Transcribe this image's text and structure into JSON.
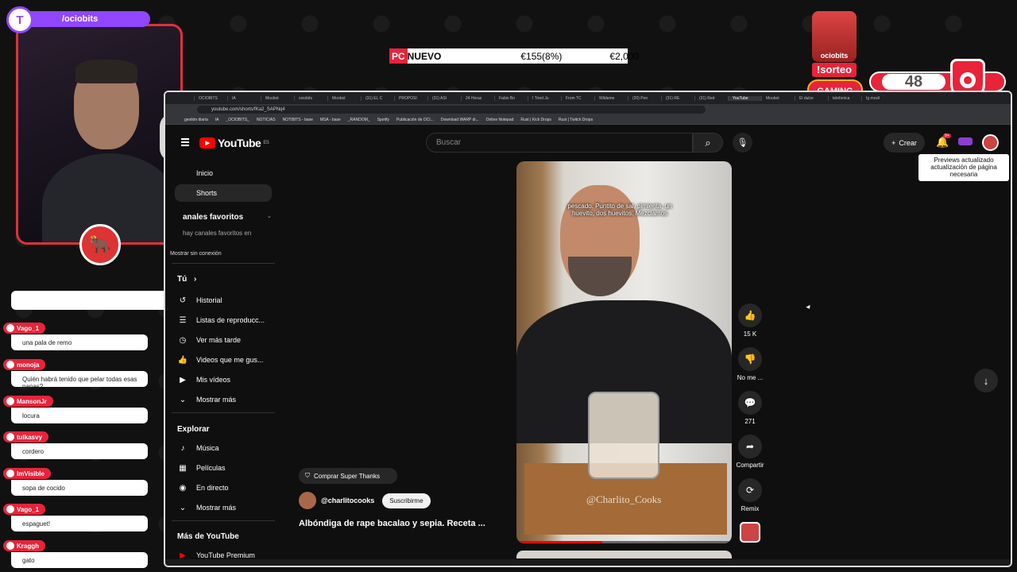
{
  "stream": {
    "channel": "/ociobits",
    "twitch_icon": "twitch-icon",
    "ticker": {
      "brand": "PC",
      "label": "NUEVO",
      "delta": "€155(8%)",
      "price": "€2,000"
    },
    "giveaway": {
      "label": "!sorteo",
      "gift_text": "ociobits",
      "gaming_label": "GAMING",
      "counter": "48"
    }
  },
  "chat": {
    "first_snippet": "",
    "messages": [
      {
        "user": "Vago_1",
        "text": "una pala de remo"
      },
      {
        "user": "monoja",
        "text": "Quién habrá tenido que pelar todas esas papas?"
      },
      {
        "user": "MansonJr",
        "text": "locura"
      },
      {
        "user": "tulkasvy",
        "text": "cordero"
      },
      {
        "user": "ImVisible",
        "text": "sopa de cocido"
      },
      {
        "user": "Vago_1",
        "text": "espaguet!"
      },
      {
        "user": "Kraggh",
        "text": "gato"
      }
    ]
  },
  "browser": {
    "tabs": [
      "OCIOBITS",
      "IA",
      "Moobot",
      "ociobits",
      "Moobot",
      "(31) EL C",
      "PROPÓSI",
      "(31) ASÍ",
      "24 Horas",
      "Fabio Bo",
      "I Tried Ju",
      "From TC",
      "Wildeme",
      "(20) Pen",
      "(31) RE",
      "(31) Red",
      "YouTube",
      "Moobot",
      "El dulce",
      "telefonica",
      "Ig movil"
    ],
    "active_tab_index": 16,
    "url": "youtube.com/shorts/fKa2_SAPNq4",
    "bookmarks": [
      "gestión diaria",
      "IA",
      "_OCIOBITS_",
      "NOTICIAS",
      "NOTIBITS - base",
      "MSA - base",
      "_RANDOM_",
      "Spotify",
      "Publicación de OCI...",
      "Download WARP di...",
      "Online Notepad",
      "Rust | Kick Drops",
      "Rust | Twitch Drops"
    ]
  },
  "youtube": {
    "logo": "YouTube",
    "region": "ES",
    "search_placeholder": "Buscar",
    "create_label": "Crear",
    "notif_badge": "9+",
    "tooltip": "Previews actualizado actualización de página necesaria",
    "sidebar": {
      "inicio": "Inicio",
      "shorts": "Shorts",
      "favs_header": "anales favoritos",
      "favs_empty": "hay canales favoritos en",
      "offline": "Mostrar sin conexión",
      "tu": "Tú",
      "historial": "Historial",
      "listas": "Listas de reproducc...",
      "later": "Ver más tarde",
      "liked": "Videos que me gus...",
      "mine": "Mis vídeos",
      "more1": "Mostrar más",
      "explore": "Explorar",
      "music": "Música",
      "movies": "Películas",
      "live": "En directo",
      "more2": "Mostrar más",
      "moreyt": "Más de YouTube",
      "premium": "YouTube Premium"
    },
    "short": {
      "caption": "pescado. Puntito de sal, pimienta, un huevito, dos huevitos. Mezclamos",
      "watermark": "@Charlito_Cooks",
      "progress": 0.4,
      "likes": "15 K",
      "dislike": "No me ...",
      "comments": "271",
      "share": "Compartir",
      "remix": "Remix",
      "thanks": "Comprar Super Thanks",
      "channel": "@charlitocooks",
      "subscribe": "Suscribirme",
      "title": "Albóndiga de rape bacalao y sepia. Receta ..."
    }
  }
}
